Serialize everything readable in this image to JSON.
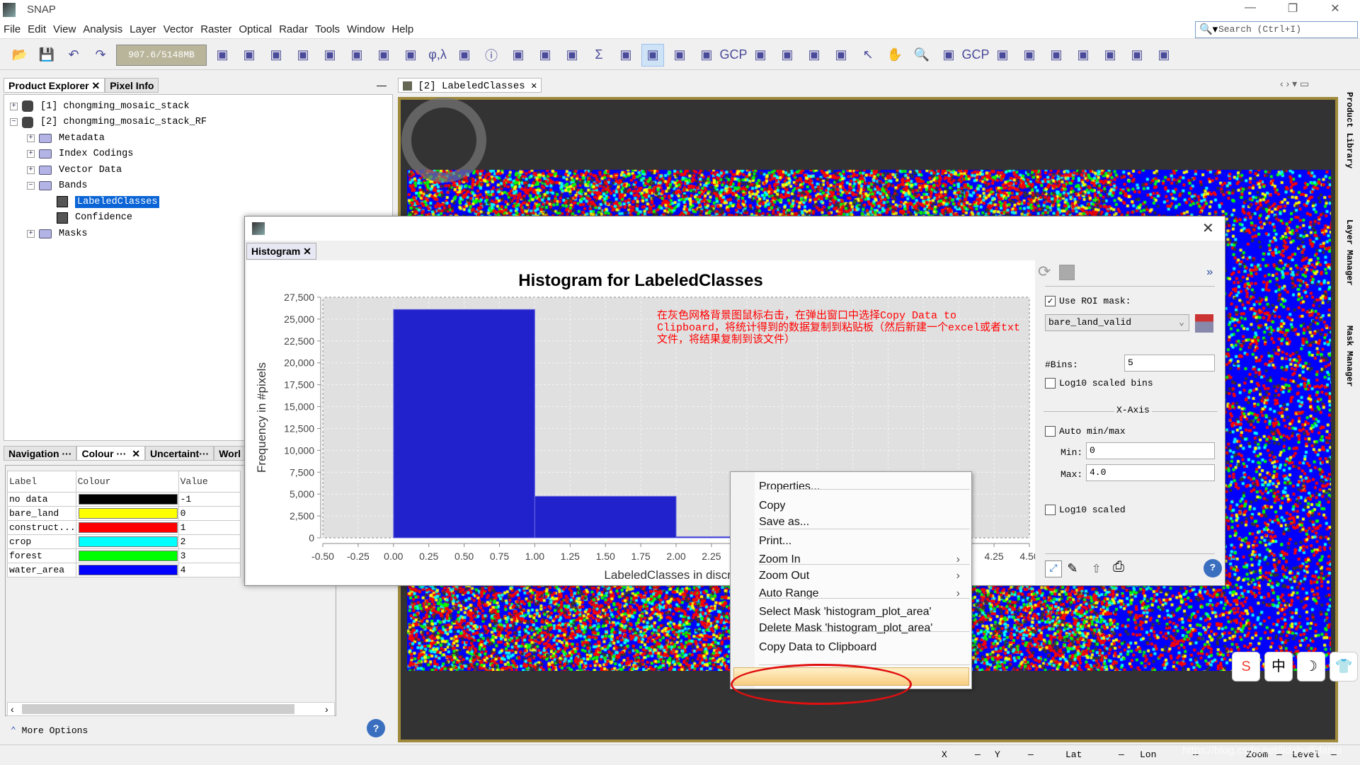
{
  "app": {
    "title": "SNAP",
    "window_controls": [
      "minimize",
      "restore",
      "close"
    ]
  },
  "menu": [
    "File",
    "Edit",
    "View",
    "Analysis",
    "Layer",
    "Vector",
    "Raster",
    "Optical",
    "Radar",
    "Tools",
    "Window",
    "Help"
  ],
  "search": {
    "placeholder": "Search (Ctrl+I)"
  },
  "toolbar": {
    "memory": "907.6/5148MB",
    "icons": [
      "open-product",
      "save-product",
      "undo",
      "redo",
      "garbage-collect",
      "import",
      "export",
      "open-rgb",
      "tile-windows",
      "world-view",
      "spectrum",
      "band-maths",
      "geo-coding",
      "histogram",
      "information",
      "statistics",
      "profile-plot",
      "scatter-plot",
      "sum",
      "overlay-none",
      "overlay-pin",
      "graticule",
      "overlay-gcp",
      "gcp",
      "overlay-shapes",
      "graph-builder",
      "batch-processing",
      "sentinel",
      "select",
      "pan",
      "zoom",
      "pin-placing",
      "gcp-placing",
      "line-drawing",
      "polyline-drawing",
      "rectangle-drawing",
      "polygon-drawing",
      "ellipse-drawing",
      "insert-figure",
      "range-finder"
    ]
  },
  "left_panel": {
    "tabs": [
      {
        "label": "Product Explorer",
        "active": true
      },
      {
        "label": "Pixel Info",
        "active": false
      }
    ],
    "tree": [
      {
        "label": "[1]  chongming_mosaic_stack",
        "level": 0,
        "expanded": false,
        "icon": "product"
      },
      {
        "label": "[2]  chongming_mosaic_stack_RF",
        "level": 0,
        "expanded": true,
        "icon": "product"
      },
      {
        "label": "Metadata",
        "level": 1,
        "expanded": false,
        "icon": "folder"
      },
      {
        "label": "Index Codings",
        "level": 1,
        "expanded": false,
        "icon": "folder"
      },
      {
        "label": "Vector Data",
        "level": 1,
        "expanded": false,
        "icon": "folder"
      },
      {
        "label": "Bands",
        "level": 1,
        "expanded": true,
        "icon": "folder"
      },
      {
        "label": "LabeledClasses",
        "level": 2,
        "selected": true,
        "icon": "band"
      },
      {
        "label": "Confidence",
        "level": 2,
        "icon": "band"
      },
      {
        "label": "Masks",
        "level": 1,
        "expanded": false,
        "icon": "folder"
      }
    ]
  },
  "bottom_panel": {
    "tabs": [
      {
        "label": "Navigation ···"
      },
      {
        "label": "Colour ···",
        "active": true
      },
      {
        "label": "Uncertaint···"
      },
      {
        "label": "Worl"
      }
    ],
    "table": {
      "headers": [
        "Label",
        "Colour",
        "Value"
      ],
      "rows": [
        {
          "label": "no data",
          "colour": "#000000",
          "value": "-1"
        },
        {
          "label": "bare_land",
          "colour": "#ffff00",
          "value": "0"
        },
        {
          "label": "construct...",
          "colour": "#ff0000",
          "value": "1"
        },
        {
          "label": "crop",
          "colour": "#00ffff",
          "value": "2"
        },
        {
          "label": "forest",
          "colour": "#00ff00",
          "value": "3"
        },
        {
          "label": "water_area",
          "colour": "#0000ff",
          "value": "4"
        }
      ]
    },
    "more_options": "More Options"
  },
  "view": {
    "tab": "[2] LabeledClasses"
  },
  "right_strip": [
    "Product Library",
    "Layer Manager",
    "Mask Manager"
  ],
  "histogram_dialog": {
    "tab": "Histogram",
    "annotation": "在灰色网格背景图鼠标右击，在弹出窗口中选择Copy Data to Clipboard，将统计得到的数据复制到粘贴板（然后新建一个excel或者txt文件，将结果复制到该文件）",
    "settings": {
      "use_roi_mask": {
        "label": "Use ROI mask:",
        "checked": true
      },
      "mask": "bare_land_valid",
      "bins_label": "#Bins:",
      "bins": "5",
      "log_bins": {
        "label": "Log10 scaled bins",
        "checked": false
      },
      "xaxis_title": "X-Axis",
      "auto_minmax": {
        "label": "Auto min/max",
        "checked": false
      },
      "min_label": "Min:",
      "min": "0",
      "max_label": "Max:",
      "max": "4.0",
      "log_scaled": {
        "label": "Log10 scaled",
        "checked": false
      }
    }
  },
  "chart_data": {
    "type": "bar",
    "title": "Histogram for LabeledClasses",
    "xlabel": "LabeledClasses in discrete",
    "ylabel": "Frequency in #pixels",
    "xlim": [
      -0.5,
      4.5
    ],
    "ylim": [
      0,
      27500
    ],
    "x_tick_step": 0.25,
    "y_tick_step": 2500,
    "grid": true,
    "bins": [
      {
        "from": 0,
        "to": 1,
        "value": 26100
      },
      {
        "from": 1,
        "to": 2,
        "value": 4750
      },
      {
        "from": 2,
        "to": 3,
        "value": 130
      }
    ],
    "bar_color": "#2222cc",
    "plot_bg": "#e0e0e0"
  },
  "context_menu": {
    "items": [
      {
        "label": "Properties...",
        "submenu": false
      },
      {
        "label": "Copy",
        "submenu": false
      },
      {
        "label": "Save as...",
        "submenu": false
      },
      {
        "label": "Print...",
        "submenu": false
      },
      {
        "label": "Zoom In",
        "submenu": true
      },
      {
        "label": "Zoom Out",
        "submenu": true
      },
      {
        "label": "Auto Range",
        "submenu": true
      },
      {
        "label": "Select Mask 'histogram_plot_area'",
        "submenu": false
      },
      {
        "label": "Delete Mask 'histogram_plot_area'",
        "submenu": false
      },
      {
        "label": "Copy Data to Clipboard",
        "submenu": false,
        "highlighted": true
      }
    ]
  },
  "status": {
    "x": "X",
    "x_val": "—",
    "y": "Y",
    "y_val": "—",
    "lat": "Lat",
    "lat_val": "—",
    "lon": "Lon",
    "lon_val": "—",
    "zoom": "Zoom",
    "zoom_val": "—",
    "level": "Level",
    "level_val": "—"
  },
  "watermark": "https://blog.csdn.net/lidahuilidahui",
  "ime": [
    "S",
    "中",
    "☽",
    "👕"
  ]
}
